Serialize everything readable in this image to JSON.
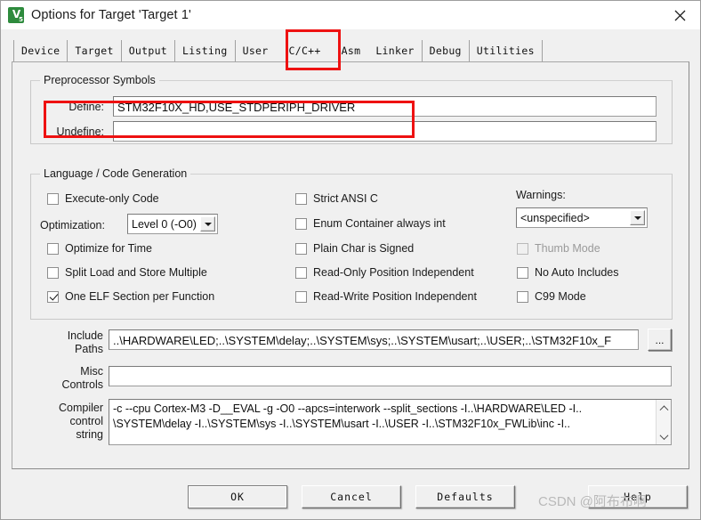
{
  "window": {
    "title": "Options for Target 'Target 1'",
    "icon_name": "keil-uvision-logo",
    "icon_label": "V",
    "icon_sub": "5",
    "close_label": "✕",
    "accent_red": "#ee1111"
  },
  "tabs": [
    {
      "label": "Device",
      "active": false
    },
    {
      "label": "Target",
      "active": false
    },
    {
      "label": "Output",
      "active": false
    },
    {
      "label": "Listing",
      "active": false
    },
    {
      "label": "User",
      "active": false
    },
    {
      "label": "C/C++",
      "active": true
    },
    {
      "label": "Asm",
      "active": false
    },
    {
      "label": "Linker",
      "active": false
    },
    {
      "label": "Debug",
      "active": false
    },
    {
      "label": "Utilities",
      "active": false
    }
  ],
  "preprocessor": {
    "legend": "Preprocessor Symbols",
    "define_label": "Define:",
    "define_value": "STM32F10X_HD,USE_STDPERIPH_DRIVER",
    "undefine_label": "Undefine:",
    "undefine_value": ""
  },
  "language": {
    "legend": "Language / Code Generation",
    "col1": [
      {
        "label": "Execute-only Code",
        "checked": false,
        "disabled": false
      },
      {
        "label": "Optimize for Time",
        "checked": false,
        "disabled": false
      },
      {
        "label": "Split Load and Store Multiple",
        "checked": false,
        "disabled": false
      },
      {
        "label": "One ELF Section per Function",
        "checked": true,
        "disabled": false
      }
    ],
    "optimization_label": "Optimization:",
    "optimization_value": "Level 0 (-O0)",
    "col2": [
      {
        "label": "Strict ANSI C",
        "checked": false,
        "disabled": false
      },
      {
        "label": "Enum Container always int",
        "checked": false,
        "disabled": false
      },
      {
        "label": "Plain Char is Signed",
        "checked": false,
        "disabled": false
      },
      {
        "label": "Read-Only Position Independent",
        "checked": false,
        "disabled": false
      },
      {
        "label": "Read-Write Position Independent",
        "checked": false,
        "disabled": false
      }
    ],
    "warnings_label": "Warnings:",
    "warnings_value": "<unspecified>",
    "col3": [
      {
        "label": "Thumb Mode",
        "checked": false,
        "disabled": true
      },
      {
        "label": "No Auto Includes",
        "checked": false,
        "disabled": false
      },
      {
        "label": "C99 Mode",
        "checked": false,
        "disabled": false
      }
    ]
  },
  "paths": {
    "include_label_l1": "Include",
    "include_label_l2": "Paths",
    "include_value": "..\\HARDWARE\\LED;..\\SYSTEM\\delay;..\\SYSTEM\\sys;..\\SYSTEM\\usart;..\\USER;..\\STM32F10x_F",
    "browse_label": "...",
    "misc_label_l1": "Misc",
    "misc_label_l2": "Controls",
    "misc_value": "",
    "compiler_label_l1": "Compiler",
    "compiler_label_l2": "control",
    "compiler_label_l3": "string",
    "compiler_line1": "-c --cpu Cortex-M3 -D__EVAL -g -O0 --apcs=interwork --split_sections -I..\\HARDWARE\\LED -I..",
    "compiler_line2": "\\SYSTEM\\delay -I..\\SYSTEM\\sys -I..\\SYSTEM\\usart -I..\\USER -I..\\STM32F10x_FWLib\\inc -I.."
  },
  "buttons": {
    "ok": "OK",
    "cancel": "Cancel",
    "defaults": "Defaults",
    "help": "Help"
  },
  "watermark": "CSDN @阿布布啊"
}
